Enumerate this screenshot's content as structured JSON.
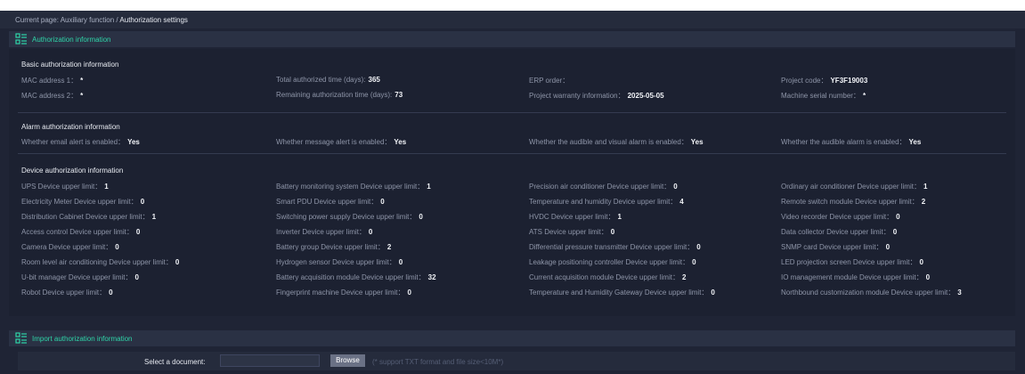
{
  "breadcrumb": {
    "prefix": "Current page: Auxiliary function / ",
    "current": "Authorization settings"
  },
  "auth_info": {
    "title": "Authorization information"
  },
  "basic": {
    "title": "Basic authorization information",
    "items": [
      [
        "MAC address 1：",
        "*"
      ],
      [
        "Total authorized time (days):",
        "365"
      ],
      [
        "ERP order：",
        ""
      ],
      [
        "Project code：",
        "YF3F19003"
      ],
      [
        "MAC address 2：",
        "*"
      ],
      [
        "Remaining authorization time (days):",
        "73"
      ],
      [
        "Project warranty information：",
        "2025-05-05"
      ],
      [
        "Machine serial number：",
        "*"
      ]
    ]
  },
  "alarm": {
    "title": "Alarm authorization information",
    "items": [
      [
        "Whether email alert is enabled：",
        "Yes"
      ],
      [
        "Whether message alert is enabled：",
        "Yes"
      ],
      [
        "Whether the audible and visual alarm is enabled：",
        "Yes"
      ],
      [
        "Whether the audible alarm is enabled：",
        "Yes"
      ]
    ]
  },
  "device": {
    "title": "Device authorization information",
    "items": [
      [
        "UPS Device upper limit：",
        "1"
      ],
      [
        "Battery monitoring system Device upper limit：",
        "1"
      ],
      [
        "Precision air conditioner Device upper limit：",
        "0"
      ],
      [
        "Ordinary air conditioner Device upper limit：",
        "1"
      ],
      [
        "Electricity Meter Device upper limit：",
        "0"
      ],
      [
        "Smart PDU Device upper limit：",
        "0"
      ],
      [
        "Temperature and humidity Device upper limit：",
        "4"
      ],
      [
        "Remote switch module Device upper limit：",
        "2"
      ],
      [
        "Distribution Cabinet Device upper limit：",
        "1"
      ],
      [
        "Switching power supply Device upper limit：",
        "0"
      ],
      [
        "HVDC Device upper limit：",
        "1"
      ],
      [
        "Video recorder Device upper limit：",
        "0"
      ],
      [
        "Access control Device upper limit：",
        "0"
      ],
      [
        "Inverter Device upper limit：",
        "0"
      ],
      [
        "ATS Device upper limit：",
        "0"
      ],
      [
        "Data collector Device upper limit：",
        "0"
      ],
      [
        "Camera Device upper limit：",
        "0"
      ],
      [
        "Battery group Device upper limit：",
        "2"
      ],
      [
        "Differential pressure transmitter Device upper limit：",
        "0"
      ],
      [
        "SNMP card Device upper limit：",
        "0"
      ],
      [
        "Room level air conditioning Device upper limit：",
        "0"
      ],
      [
        "Hydrogen sensor Device upper limit：",
        "0"
      ],
      [
        "Leakage positioning controller Device upper limit：",
        "0"
      ],
      [
        "LED projection screen Device upper limit：",
        "0"
      ],
      [
        "U-bit manager Device upper limit：",
        "0"
      ],
      [
        "Battery acquisition module Device upper limit：",
        "32"
      ],
      [
        "Current acquisition module Device upper limit：",
        "2"
      ],
      [
        "IO management module Device upper limit：",
        "0"
      ],
      [
        "Robot Device upper limit：",
        "0"
      ],
      [
        "Fingerprint machine Device upper limit：",
        "0"
      ],
      [
        "Temperature and Humidity Gateway Device upper limit：",
        "0"
      ],
      [
        "Northbound customization module Device upper limit：",
        "3"
      ]
    ]
  },
  "import": {
    "title": "Import authorization information",
    "select_label": "Select a document:",
    "browse_label": "Browse",
    "hint": "(* support TXT format and file size<10M*)"
  },
  "colors": {
    "accent": "#2fd4a8",
    "background": "#1f2435",
    "panel": "#1c2131"
  },
  "icons": {
    "section": "list-icon"
  }
}
